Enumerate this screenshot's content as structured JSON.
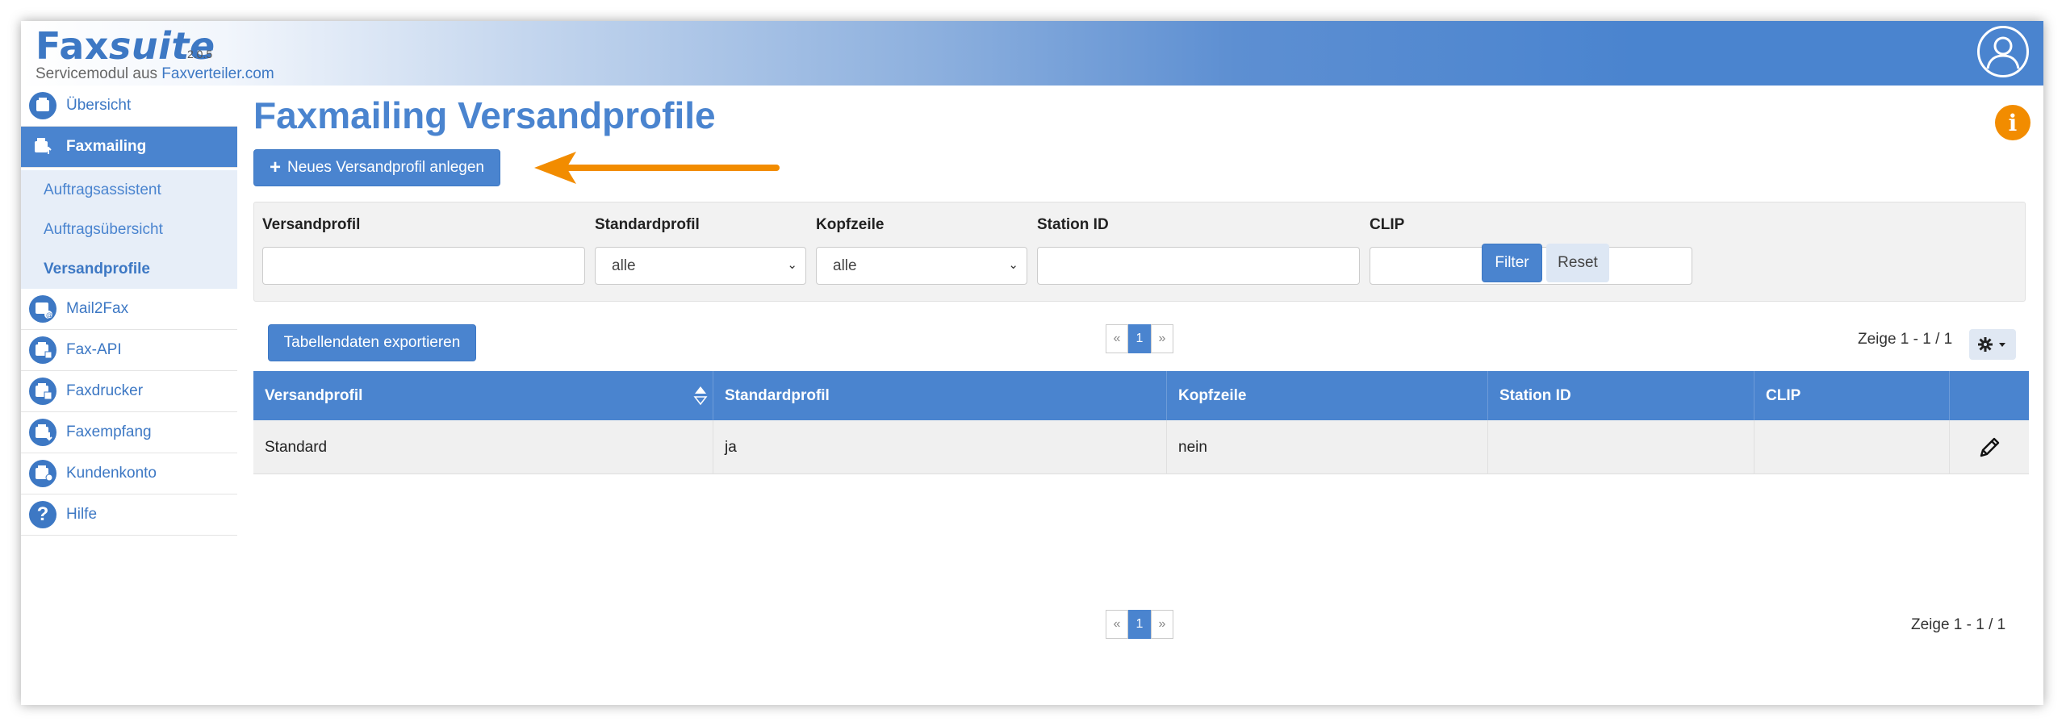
{
  "header": {
    "brand_part1": "Fax",
    "brand_part2": "suite",
    "version": "2.0.5",
    "subtitle_prefix": "Servicemodul aus ",
    "subtitle_link": "Faxverteiler.com"
  },
  "sidebar": {
    "items": [
      {
        "label": "Übersicht",
        "icon": "overview-icon"
      },
      {
        "label": "Faxmailing",
        "icon": "faxmailing-icon"
      },
      {
        "label": "Mail2Fax",
        "icon": "mail2fax-icon"
      },
      {
        "label": "Fax-API",
        "icon": "fax-api-icon"
      },
      {
        "label": "Faxdrucker",
        "icon": "printer-icon"
      },
      {
        "label": "Faxempfang",
        "icon": "fax-receive-icon"
      },
      {
        "label": "Kundenkonto",
        "icon": "account-icon"
      },
      {
        "label": "Hilfe",
        "icon": "help-icon"
      }
    ],
    "sub_items": [
      {
        "label": "Auftragsassistent"
      },
      {
        "label": "Auftragsübersicht"
      },
      {
        "label": "Versandprofile"
      }
    ]
  },
  "main": {
    "title": "Faxmailing Versandprofile",
    "new_profile_label": "Neues Versandprofil anlegen",
    "export_label": "Tabellendaten exportieren"
  },
  "filter": {
    "labels": {
      "versandprofil": "Versandprofil",
      "standardprofil": "Standardprofil",
      "kopfzeile": "Kopfzeile",
      "station_id": "Station ID",
      "clip": "CLIP"
    },
    "standardprofil_value": "alle",
    "kopfzeile_value": "alle",
    "filter_label": "Filter",
    "reset_label": "Reset"
  },
  "pagination": {
    "prev": "«",
    "current": "1",
    "next": "»",
    "count_text": "Zeige 1 - 1 / 1"
  },
  "table": {
    "columns": [
      "Versandprofil",
      "Standardprofil",
      "Kopfzeile",
      "Station ID",
      "CLIP"
    ],
    "rows": [
      {
        "versandprofil": "Standard",
        "standardprofil": "ja",
        "kopfzeile": "nein",
        "station_id": "",
        "clip": ""
      }
    ]
  },
  "colors": {
    "accent": "#4a84cf",
    "brand": "#3d78c4",
    "info": "#f28c00",
    "arrow": "#f28c00"
  }
}
